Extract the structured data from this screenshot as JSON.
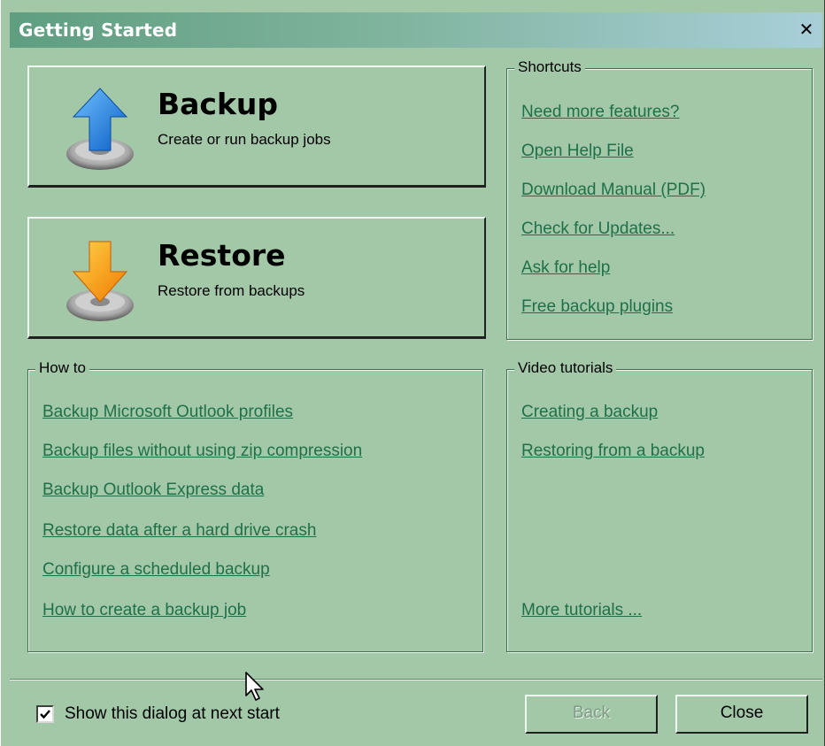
{
  "window": {
    "title": "Getting Started",
    "close_glyph": "✕"
  },
  "backup": {
    "label": "Backup",
    "sub": "Create or run backup jobs",
    "icon": "upload-arrow-icon"
  },
  "restore": {
    "label": "Restore",
    "sub": "Restore from backups",
    "icon": "download-arrow-icon"
  },
  "shortcuts": {
    "legend": "Shortcuts",
    "links": [
      "Need more features?",
      "Open Help File",
      "Download Manual (PDF)",
      "Check for Updates...",
      "Ask for help",
      "Free backup plugins"
    ]
  },
  "howto": {
    "legend": "How to",
    "links": [
      "Backup Microsoft Outlook profiles",
      "Backup files without using zip compression",
      "Backup Outlook Express data",
      "Restore data after a hard drive crash",
      "Configure a scheduled backup",
      "How to create a backup job"
    ]
  },
  "videos": {
    "legend": "Video tutorials",
    "links": [
      "Creating a backup",
      "Restoring from a backup"
    ],
    "more": "More tutorials ..."
  },
  "footer": {
    "show_dialog_label": "Show this dialog at next start",
    "show_dialog_checked": true,
    "back_label": "Back",
    "back_enabled": false,
    "close_label": "Close"
  },
  "colors": {
    "background": "#a2c8a8",
    "link": "#1f7049",
    "title_start": "#5f9e80",
    "title_end": "#a8cfd9"
  }
}
